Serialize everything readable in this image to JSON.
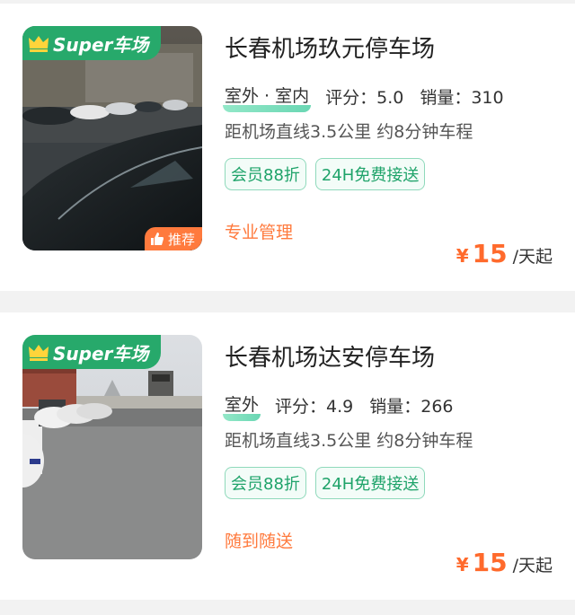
{
  "colors": {
    "accent_green": "#27a96b",
    "tag_green": "#1fa36a",
    "orange": "#ff7a3d",
    "price_orange": "#ff6a2c"
  },
  "listings": [
    {
      "super_label": "Super车场",
      "recommend_label": "推荐",
      "title": "长春机场玖元停车场",
      "location": "室外 · 室内",
      "rating": "评分：5.0",
      "sales": "销量：310",
      "distance": "距机场直线3.5公里 约8分钟车程",
      "tags": [
        "会员88折",
        "24H免费接送"
      ],
      "feature": "专业管理",
      "currency": "¥",
      "price": "15",
      "price_unit": "/天起"
    },
    {
      "super_label": "Super车场",
      "title": "长春机场达安停车场",
      "location": "室外",
      "rating": "评分：4.9",
      "sales": "销量：266",
      "distance": "距机场直线3.5公里 约8分钟车程",
      "tags": [
        "会员88折",
        "24H免费接送"
      ],
      "feature": "随到随送",
      "currency": "¥",
      "price": "15",
      "price_unit": "/天起"
    }
  ]
}
